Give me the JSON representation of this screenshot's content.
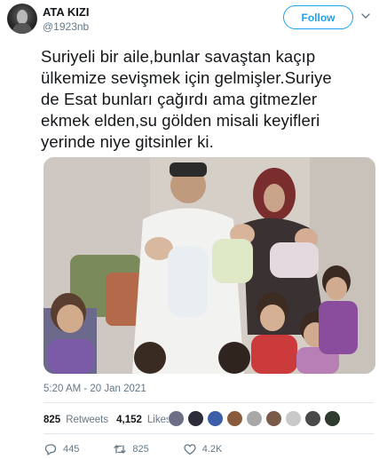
{
  "user": {
    "display_name": "ATA KIZI",
    "handle": "@1923nb"
  },
  "follow_label": "Follow",
  "tweet": {
    "lines": [
      "Suriyeli bir aile,bunlar savaştan kaçıp",
      "ülkemize sevişmek için gelmişler.Suriye",
      "de Esat bunları çağırdı ama gitmezler",
      "ekmek elden,su gölden misali keyifleri",
      "yerinde niye gitsinler ki."
    ],
    "timestamp": "5:20 AM - 20 Jan 2021"
  },
  "stats": {
    "retweets_count": "825",
    "retweets_label": "Retweets",
    "likes_count": "4,152",
    "likes_label": "Likes"
  },
  "likers": [
    "#6d6f86",
    "#2c2c3a",
    "#3b5ea8",
    "#8a5a3c",
    "#a8a8a8",
    "#7a5b4a",
    "#c9c9c9",
    "#4a4a4a",
    "#2f3b2f"
  ],
  "actions": {
    "replies": "445",
    "retweets": "825",
    "likes": "4.2K"
  },
  "colors": {
    "accent": "#1da1f2",
    "muted": "#657786",
    "text": "#14171a"
  }
}
